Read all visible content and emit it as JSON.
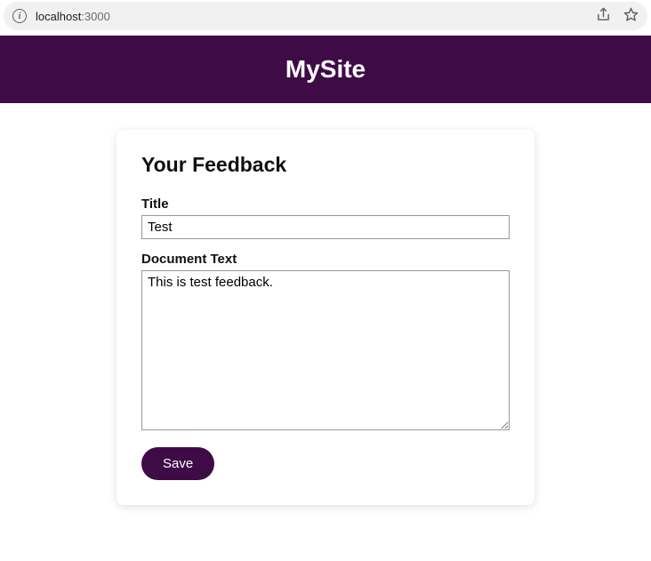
{
  "browser": {
    "url_host": "localhost",
    "url_port": ":3000"
  },
  "header": {
    "site_title": "MySite"
  },
  "form": {
    "heading": "Your Feedback",
    "title_label": "Title",
    "title_value": "Test",
    "doc_label": "Document Text",
    "doc_value": "This is test feedback.",
    "save_label": "Save"
  }
}
